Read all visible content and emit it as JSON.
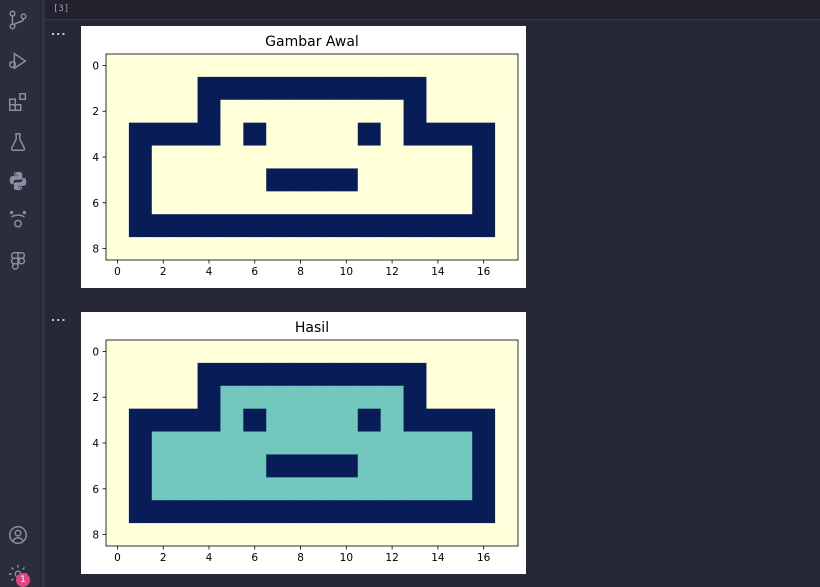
{
  "activity_bar": {
    "icons": [
      "source-control-icon",
      "run-debug-icon",
      "extensions-icon",
      "testing-icon",
      "python-icon",
      "jupyter-icon",
      "figma-icon",
      "account-icon",
      "settings-icon"
    ],
    "settings_badge": "1",
    "icon_color": "#8c8fa3",
    "badge_color": "#e2457f"
  },
  "cell": {
    "execution_count": "[3]",
    "output_menu": "...",
    "outputs": [
      {
        "menu": "...",
        "chart_data": {
          "type": "heatmap",
          "title": "Gambar Awal",
          "xlabel": "",
          "ylabel": "",
          "xticks": [
            "0",
            "2",
            "4",
            "6",
            "8",
            "10",
            "12",
            "14",
            "16"
          ],
          "yticks": [
            "0",
            "2",
            "4",
            "6",
            "8"
          ],
          "xlim": [
            -0.5,
            17.5
          ],
          "ylim": [
            8.5,
            -0.5
          ],
          "colormap": {
            "0": "#ffffd9",
            "1": "#081d58",
            "2": "#73c8bd"
          },
          "grid": [
            [
              0,
              0,
              0,
              0,
              0,
              0,
              0,
              0,
              0,
              0,
              0,
              0,
              0,
              0,
              0,
              0,
              0,
              0
            ],
            [
              0,
              0,
              0,
              0,
              1,
              1,
              1,
              1,
              1,
              1,
              1,
              1,
              1,
              1,
              0,
              0,
              0,
              0
            ],
            [
              0,
              0,
              0,
              0,
              1,
              0,
              0,
              0,
              0,
              0,
              0,
              0,
              0,
              1,
              0,
              0,
              0,
              0
            ],
            [
              0,
              1,
              1,
              1,
              1,
              0,
              1,
              0,
              0,
              0,
              0,
              1,
              0,
              1,
              1,
              1,
              1,
              0
            ],
            [
              0,
              1,
              0,
              0,
              0,
              0,
              0,
              0,
              0,
              0,
              0,
              0,
              0,
              0,
              0,
              0,
              1,
              0
            ],
            [
              0,
              1,
              0,
              0,
              0,
              0,
              0,
              1,
              1,
              1,
              1,
              0,
              0,
              0,
              0,
              0,
              1,
              0
            ],
            [
              0,
              1,
              0,
              0,
              0,
              0,
              0,
              0,
              0,
              0,
              0,
              0,
              0,
              0,
              0,
              0,
              1,
              0
            ],
            [
              0,
              1,
              1,
              1,
              1,
              1,
              1,
              1,
              1,
              1,
              1,
              1,
              1,
              1,
              1,
              1,
              1,
              0
            ],
            [
              0,
              0,
              0,
              0,
              0,
              0,
              0,
              0,
              0,
              0,
              0,
              0,
              0,
              0,
              0,
              0,
              0,
              0
            ]
          ]
        }
      },
      {
        "menu": "...",
        "chart_data": {
          "type": "heatmap",
          "title": "Hasil",
          "xlabel": "",
          "ylabel": "",
          "xticks": [
            "0",
            "2",
            "4",
            "6",
            "8",
            "10",
            "12",
            "14",
            "16"
          ],
          "yticks": [
            "0",
            "2",
            "4",
            "6",
            "8"
          ],
          "xlim": [
            -0.5,
            17.5
          ],
          "ylim": [
            8.5,
            -0.5
          ],
          "colormap": {
            "0": "#ffffd9",
            "1": "#081d58",
            "2": "#73c8bd"
          },
          "grid": [
            [
              0,
              0,
              0,
              0,
              0,
              0,
              0,
              0,
              0,
              0,
              0,
              0,
              0,
              0,
              0,
              0,
              0,
              0
            ],
            [
              0,
              0,
              0,
              0,
              1,
              1,
              1,
              1,
              1,
              1,
              1,
              1,
              1,
              1,
              0,
              0,
              0,
              0
            ],
            [
              0,
              0,
              0,
              0,
              1,
              2,
              2,
              2,
              2,
              2,
              2,
              2,
              2,
              1,
              0,
              0,
              0,
              0
            ],
            [
              0,
              1,
              1,
              1,
              1,
              2,
              1,
              2,
              2,
              2,
              2,
              1,
              2,
              1,
              1,
              1,
              1,
              0
            ],
            [
              0,
              1,
              2,
              2,
              2,
              2,
              2,
              2,
              2,
              2,
              2,
              2,
              2,
              2,
              2,
              2,
              1,
              0
            ],
            [
              0,
              1,
              2,
              2,
              2,
              2,
              2,
              1,
              1,
              1,
              1,
              2,
              2,
              2,
              2,
              2,
              1,
              0
            ],
            [
              0,
              1,
              2,
              2,
              2,
              2,
              2,
              2,
              2,
              2,
              2,
              2,
              2,
              2,
              2,
              2,
              1,
              0
            ],
            [
              0,
              1,
              1,
              1,
              1,
              1,
              1,
              1,
              1,
              1,
              1,
              1,
              1,
              1,
              1,
              1,
              1,
              0
            ],
            [
              0,
              0,
              0,
              0,
              0,
              0,
              0,
              0,
              0,
              0,
              0,
              0,
              0,
              0,
              0,
              0,
              0,
              0
            ]
          ]
        }
      }
    ]
  }
}
